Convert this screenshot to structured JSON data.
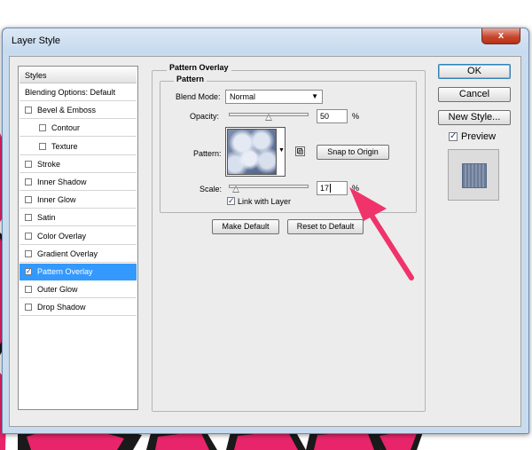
{
  "window": {
    "title": "Layer Style",
    "close_glyph": "x"
  },
  "styles_panel": {
    "header": "Styles",
    "items": [
      {
        "label": "Blending Options: Default",
        "has_checkbox": false,
        "checked": false,
        "selected": false
      },
      {
        "label": "Bevel & Emboss",
        "has_checkbox": true,
        "checked": false,
        "selected": false
      },
      {
        "label": "Contour",
        "has_checkbox": true,
        "checked": false,
        "selected": false
      },
      {
        "label": "Texture",
        "has_checkbox": true,
        "checked": false,
        "selected": false
      },
      {
        "label": "Stroke",
        "has_checkbox": true,
        "checked": false,
        "selected": false
      },
      {
        "label": "Inner Shadow",
        "has_checkbox": true,
        "checked": false,
        "selected": false
      },
      {
        "label": "Inner Glow",
        "has_checkbox": true,
        "checked": false,
        "selected": false
      },
      {
        "label": "Satin",
        "has_checkbox": true,
        "checked": false,
        "selected": false
      },
      {
        "label": "Color Overlay",
        "has_checkbox": true,
        "checked": false,
        "selected": false
      },
      {
        "label": "Gradient Overlay",
        "has_checkbox": true,
        "checked": false,
        "selected": false
      },
      {
        "label": "Pattern Overlay",
        "has_checkbox": true,
        "checked": true,
        "selected": true
      },
      {
        "label": "Outer Glow",
        "has_checkbox": true,
        "checked": false,
        "selected": false
      },
      {
        "label": "Drop Shadow",
        "has_checkbox": true,
        "checked": false,
        "selected": false
      }
    ]
  },
  "pattern_overlay": {
    "section_title": "Pattern Overlay",
    "group_title": "Pattern",
    "blend_mode_label": "Blend Mode:",
    "blend_mode_value": "Normal",
    "opacity_label": "Opacity:",
    "opacity_value": "50",
    "opacity_percent": 50,
    "percent_sign": "%",
    "pattern_label": "Pattern:",
    "snap_button": "Snap to Origin",
    "scale_label": "Scale:",
    "scale_value": "17",
    "scale_percent": 17,
    "link_with_layer_label": "Link with Layer",
    "link_with_layer_checked": true,
    "make_default_button": "Make Default",
    "reset_default_button": "Reset to Default"
  },
  "actions": {
    "ok": "OK",
    "cancel": "Cancel",
    "new_style": "New Style...",
    "preview_label": "Preview",
    "preview_checked": true
  },
  "colors": {
    "annotation_arrow": "#f0336b",
    "selection": "#3399ff",
    "background_art_pink": "#e8246a"
  },
  "icons": {
    "pattern_dropdown": "triangle-down-icon",
    "new_preset": "new-preset-icon",
    "check": "checkmark-icon"
  }
}
